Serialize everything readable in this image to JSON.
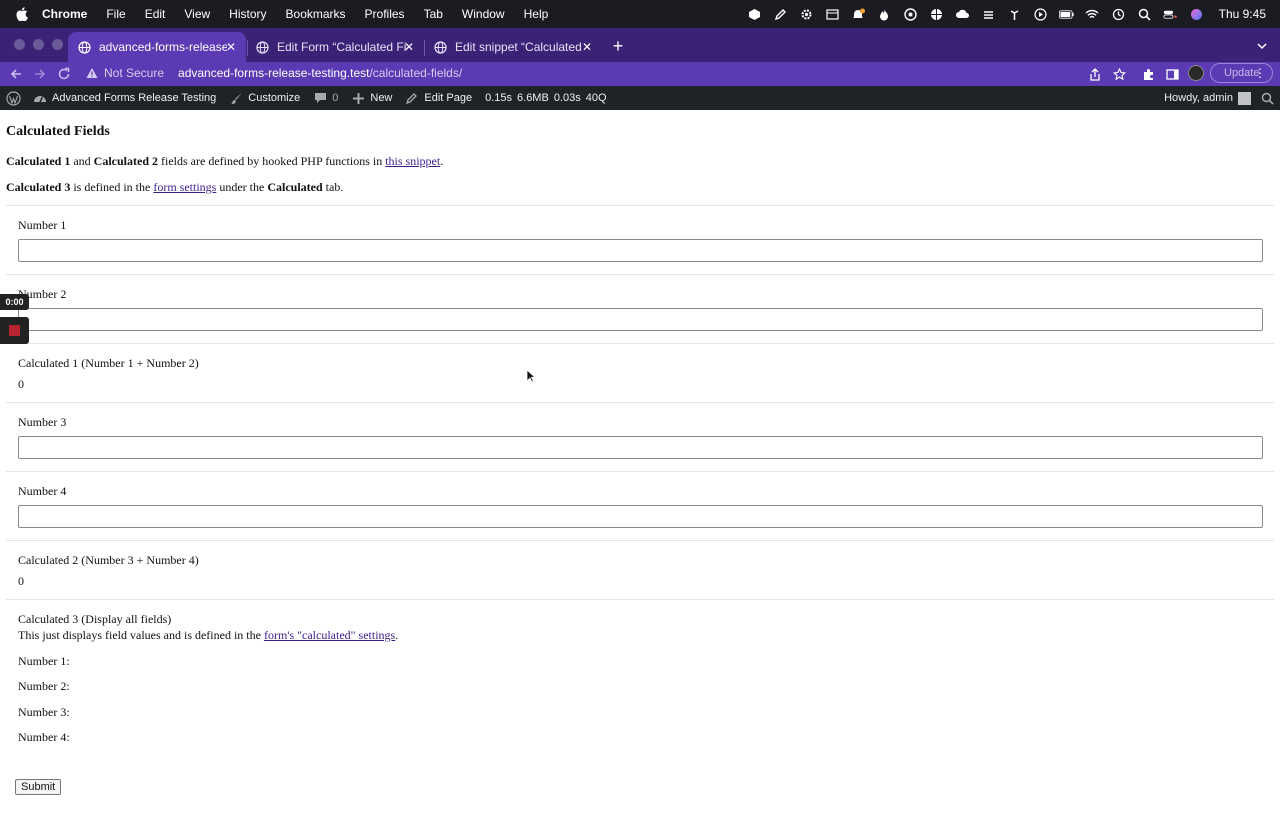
{
  "mac_menubar": {
    "app": "Chrome",
    "menus": [
      "File",
      "Edit",
      "View",
      "History",
      "Bookmarks",
      "Profiles",
      "Tab",
      "Window",
      "Help"
    ],
    "clock": "Thu  9:45"
  },
  "browser": {
    "tabs": [
      {
        "title": "advanced-forms-release-testi"
      },
      {
        "title": "Edit Form “Calculated Fields” ‹"
      },
      {
        "title": "Edit snippet “Calculated Fields"
      }
    ],
    "address": {
      "security_label": "Not Secure",
      "host": "advanced-forms-release-testing.test",
      "path": "/calculated-fields/"
    },
    "update_label": "Update"
  },
  "adminbar": {
    "site_name": "Advanced Forms Release Testing",
    "customize": "Customize",
    "comments": "0",
    "new": "New",
    "edit_page": "Edit Page",
    "stats": [
      "0.15s",
      "6.6MB",
      "0.03s",
      "40Q"
    ],
    "howdy": "Howdy, admin"
  },
  "page": {
    "title": "Calculated Fields",
    "intro1": {
      "b1": "Calculated 1",
      "t1": " and ",
      "b2": "Calculated 2",
      "t2": " fields are defined by hooked PHP functions in ",
      "link": "this snippet",
      "t3": "."
    },
    "intro2": {
      "b1": "Calculated 3",
      "t1": " is defined in the ",
      "link": "form settings",
      "t2": " under the ",
      "b2": "Calculated",
      "t3": " tab."
    },
    "fields": {
      "number1_label": "Number 1",
      "number1_value": "",
      "number2_label": "Number 2",
      "number2_value": "",
      "calc1_label": "Calculated 1 (Number 1 + Number 2)",
      "calc1_value": "0",
      "number3_label": "Number 3",
      "number3_value": "",
      "number4_label": "Number 4",
      "number4_value": "",
      "calc2_label": "Calculated 2 (Number 3 + Number 4)",
      "calc2_value": "0",
      "calc3_label": "Calculated 3 (Display all fields)",
      "calc3_desc_text": "This just displays field values and is defined in the ",
      "calc3_desc_link": "form's \"calculated\" settings",
      "calc3_desc_end": ".",
      "calc3_lines": [
        "Number 1:",
        "Number 2:",
        "Number 3:",
        "Number 4:"
      ]
    },
    "submit_label": "Submit"
  },
  "recording": {
    "time": "0:00"
  }
}
